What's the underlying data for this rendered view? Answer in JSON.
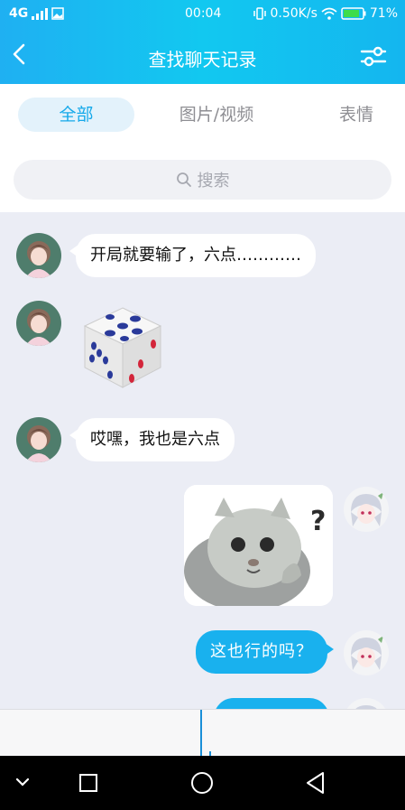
{
  "status_bar": {
    "network": "4G",
    "time": "00:04",
    "speed": "0.50K/s",
    "battery": "71%"
  },
  "header": {
    "title": "查找聊天记录"
  },
  "tabs": [
    {
      "label": "全部",
      "active": true
    },
    {
      "label": "图片/视频",
      "active": false
    },
    {
      "label": "表情",
      "active": false
    }
  ],
  "search": {
    "placeholder": "搜索"
  },
  "messages": [
    {
      "side": "left",
      "type": "text",
      "text": "开局就要输了，六点…………"
    },
    {
      "side": "left",
      "type": "sticker",
      "sticker": "dice-six"
    },
    {
      "side": "left",
      "type": "text",
      "text": "哎嘿，我也是六点"
    },
    {
      "side": "right",
      "type": "image",
      "image": "confused-cat-meme"
    },
    {
      "side": "right",
      "type": "text",
      "text": "这也行的吗？"
    },
    {
      "side": "right",
      "type": "text",
      "text": ""
    }
  ],
  "colors": {
    "header_start": "#1fb0f2",
    "accent": "#15a9ea",
    "chat_bg": "#ebedf5",
    "bubble_blue": "#19b1ee"
  },
  "icons": [
    "back-arrow-icon",
    "filter-sliders-icon",
    "search-icon",
    "nav-back-icon",
    "nav-home-icon",
    "nav-recents-icon",
    "nav-down-icon"
  ]
}
